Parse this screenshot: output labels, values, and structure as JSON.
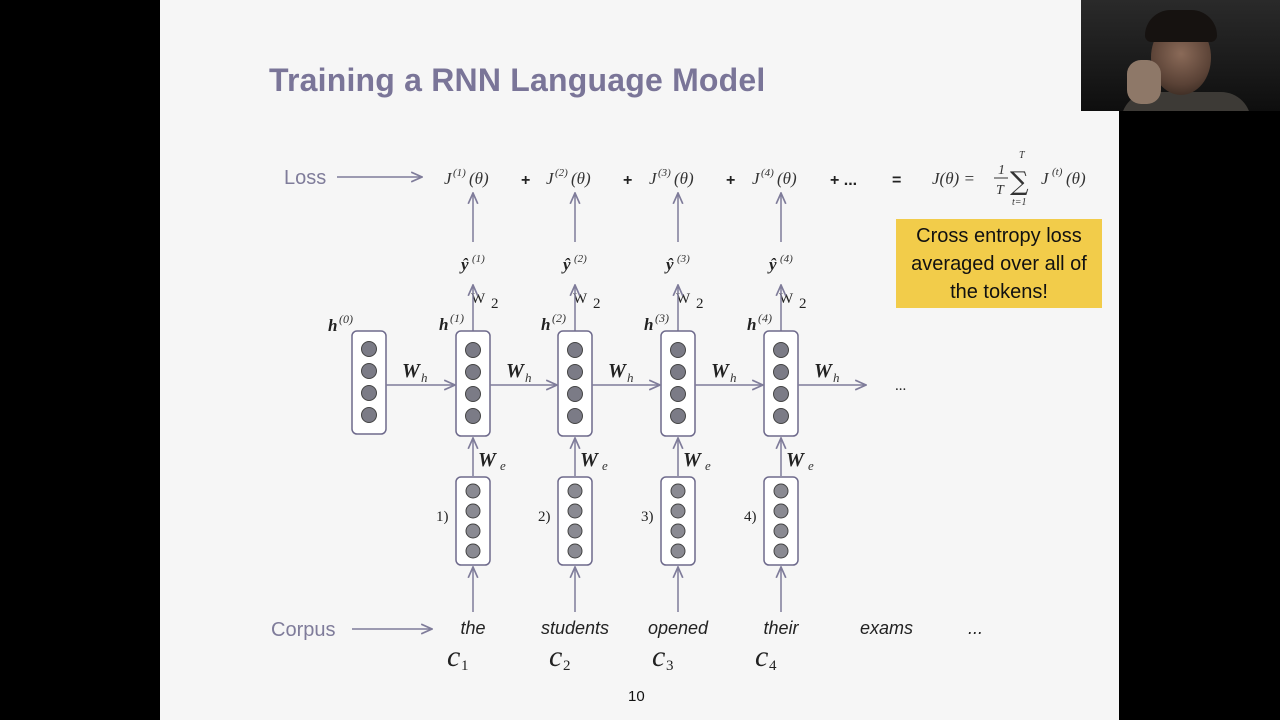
{
  "slide": {
    "title": "Training a RNN Language Model",
    "page_number": "10",
    "callout_lines": [
      "Cross entropy loss",
      "averaged over all of",
      "the tokens!"
    ]
  },
  "diagram": {
    "loss_label": "Loss",
    "corpus_label": "Corpus",
    "ellipsis": "...",
    "plus_ellipsis": "+ ...",
    "equals": "=",
    "plus": "+",
    "j_symbol": "J",
    "theta": "(θ)",
    "sum_lhs": "J(θ) =",
    "frac_num": "1",
    "frac_den": "T",
    "sum_sign": "∑",
    "sum_upper": "T",
    "sum_lower": "t=1",
    "sum_term": "J",
    "sum_term_sup": "(t)",
    "sum_term_arg": "(θ)",
    "h0_label": "h",
    "h0_sup": "(0)",
    "wh": "W",
    "wh_sub": "h",
    "we": "W",
    "we_sub": "e",
    "w2": "W",
    "w2_sub": "2",
    "yhat": "ŷ",
    "h_symbol": "h",
    "c_symbol": "c",
    "steps": [
      {
        "loss_sup": "(1)",
        "y_sup": "(1)",
        "h_sup": "(1)",
        "e_label": "1)",
        "word": "the",
        "c_sub": "1"
      },
      {
        "loss_sup": "(2)",
        "y_sup": "(2)",
        "h_sup": "(2)",
        "e_label": "2)",
        "word": "students",
        "c_sub": "2"
      },
      {
        "loss_sup": "(3)",
        "y_sup": "(3)",
        "h_sup": "(3)",
        "e_label": "3)",
        "word": "opened",
        "c_sub": "3"
      },
      {
        "loss_sup": "(4)",
        "y_sup": "(4)",
        "h_sup": "(4)",
        "e_label": "4)",
        "word": "their",
        "c_sub": "4"
      }
    ],
    "extra_word": "exams",
    "corpus_ellipsis": "..."
  },
  "colors": {
    "title": "#7a7598",
    "label": "#7f7c9a",
    "arrow": "#7f7c9a",
    "callout_bg": "#f2cc4a",
    "neuron": "#7b7b86",
    "box_border": "#6e6a8c"
  }
}
